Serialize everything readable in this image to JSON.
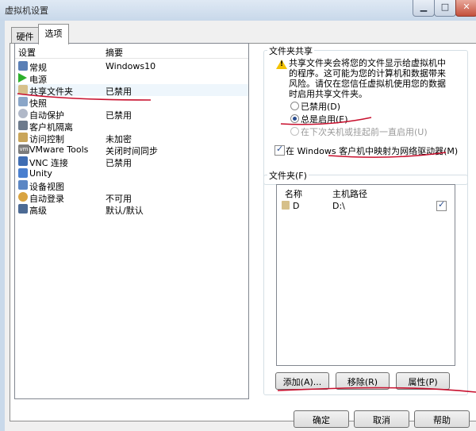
{
  "window": {
    "title": "虚拟机设置"
  },
  "tabs": [
    {
      "label": "硬件"
    },
    {
      "label": "选项"
    }
  ],
  "settings_list": {
    "col_setting": "设置",
    "col_summary": "摘要",
    "items": [
      {
        "label": "常规",
        "summary": "Windows10",
        "icon": "monitor-icon"
      },
      {
        "label": "电源",
        "summary": "",
        "icon": "play-icon"
      },
      {
        "label": "共享文件夹",
        "summary": "已禁用",
        "icon": "shared-folder-icon"
      },
      {
        "label": "快照",
        "summary": "",
        "icon": "snapshot-icon"
      },
      {
        "label": "自动保护",
        "summary": "已禁用",
        "icon": "autoprotect-icon"
      },
      {
        "label": "客户机隔离",
        "summary": "",
        "icon": "isolation-icon"
      },
      {
        "label": "访问控制",
        "summary": "未加密",
        "icon": "access-control-icon"
      },
      {
        "label": "VMware Tools",
        "summary": "关闭时间同步",
        "icon": "vmware-tools-icon"
      },
      {
        "label": "VNC 连接",
        "summary": "已禁用",
        "icon": "vnc-icon"
      },
      {
        "label": "Unity",
        "summary": "",
        "icon": "unity-icon"
      },
      {
        "label": "设备视图",
        "summary": "",
        "icon": "device-view-icon"
      },
      {
        "label": "自动登录",
        "summary": "不可用",
        "icon": "autologin-icon"
      },
      {
        "label": "高级",
        "summary": "默认/默认",
        "icon": "advanced-icon"
      }
    ]
  },
  "folder_sharing": {
    "group_title": "文件夹共享",
    "description": [
      "共享文件夹会将您的文件显示给虚拟机中",
      "的程序。这可能为您的计算机和数据带来",
      "风险。请仅在您信任虚拟机使用您的数据",
      "时启用共享文件夹。"
    ],
    "options": [
      {
        "label": "已禁用(D)",
        "selected": false,
        "enabled": true
      },
      {
        "label": "总是启用(E)",
        "selected": true,
        "enabled": true
      },
      {
        "label": "在下次关机或挂起前一直启用(U)",
        "selected": false,
        "enabled": false
      }
    ],
    "map_drive": {
      "label": "在 Windows 客户机中映射为网络驱动器(M)",
      "checked": true
    }
  },
  "folders": {
    "group_title": "文件夹(F)",
    "col_name": "名称",
    "col_path": "主机路径",
    "rows": [
      {
        "name": "D",
        "path": "D:\\",
        "checked": true
      }
    ],
    "add_label": "添加(A)...",
    "remove_label": "移除(R)",
    "properties_label": "属性(P)"
  },
  "footer": {
    "ok_label": "确定",
    "cancel_label": "取消",
    "help_label": "帮助"
  },
  "colors": {
    "annotation_ink": "#c8102e",
    "selection_highlight": "#eef6fc",
    "warning": "#f3c200"
  }
}
